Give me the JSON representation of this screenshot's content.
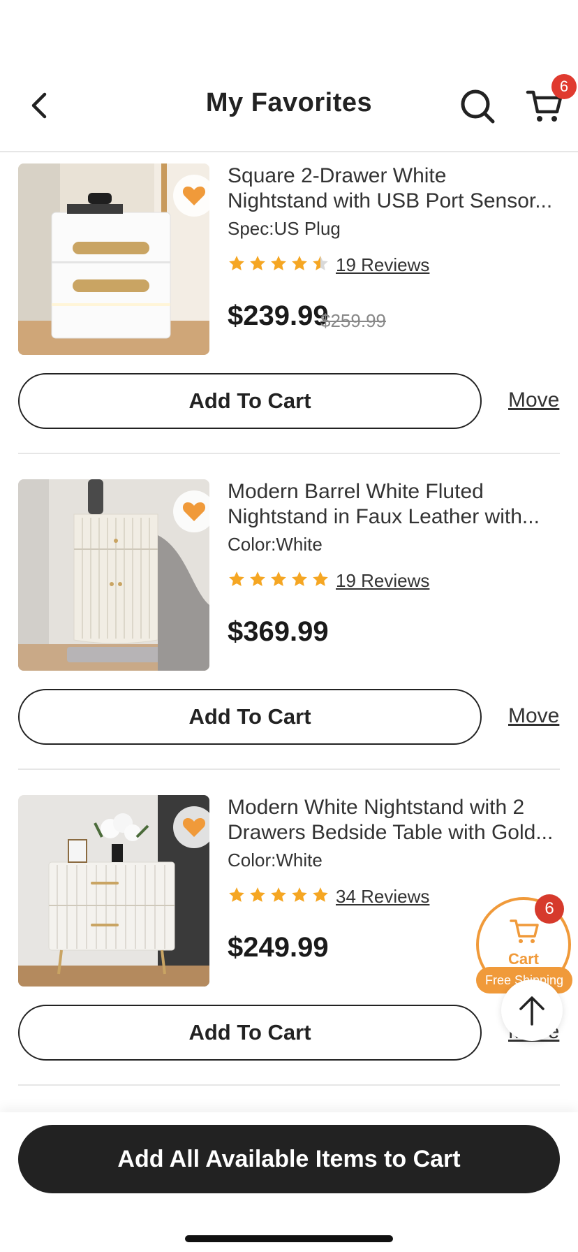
{
  "header": {
    "title": "My Favorites",
    "cart_count": "6"
  },
  "products": [
    {
      "title_line1": "Square 2-Drawer White",
      "title_line2": "Nightstand with USB Port Sensor...",
      "spec": "Spec:US Plug",
      "rating": 4.5,
      "reviews": "19 Reviews",
      "price": "$239.99",
      "original_price": "$259.99",
      "add_label": "Add To Cart",
      "move_label": "Move"
    },
    {
      "title_line1": "Modern Barrel White Fluted",
      "title_line2": "Nightstand in Faux Leather with...",
      "spec": "Color:White",
      "rating": 5,
      "reviews": "19 Reviews",
      "price": "$369.99",
      "original_price": "",
      "add_label": "Add To Cart",
      "move_label": "Move"
    },
    {
      "title_line1": "Modern White Nightstand with 2",
      "title_line2": "Drawers Bedside Table with Gold...",
      "spec": "Color:White",
      "rating": 5,
      "reviews": "34 Reviews",
      "price": "$249.99",
      "original_price": "",
      "add_label": "Add To Cart",
      "move_label": "Move"
    }
  ],
  "floating_cart": {
    "label": "Cart",
    "count": "6",
    "free_shipping": "Free Shipping"
  },
  "bottom": {
    "add_all_label": "Add All Available Items to Cart"
  },
  "colors": {
    "accent": "#f09a3a",
    "badge": "#e03a2f",
    "star": "#f5a623",
    "primary_button": "#222222"
  },
  "icons": [
    "back-icon",
    "search-icon",
    "cart-icon",
    "heart-icon",
    "star-icon",
    "arrow-up-icon"
  ]
}
